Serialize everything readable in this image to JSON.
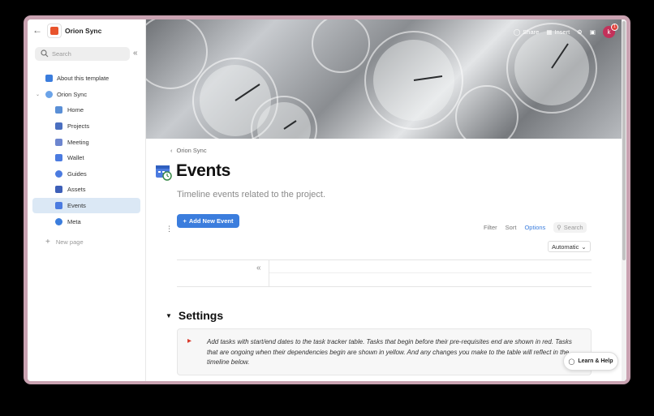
{
  "workspace": {
    "name": "Orion Sync"
  },
  "sidebar": {
    "search_placeholder": "Search",
    "items": [
      {
        "label": "About this template",
        "icon": "info-icon",
        "color": "#3b7ddd"
      },
      {
        "label": "Orion Sync",
        "icon": "workspace-icon",
        "color": "#6ba3e8"
      },
      {
        "label": "Home",
        "icon": "home-icon",
        "color": "#5a8fd6"
      },
      {
        "label": "Projects",
        "icon": "projects-icon",
        "color": "#4a6fc0"
      },
      {
        "label": "Meeting",
        "icon": "meeting-icon",
        "color": "#6d86cf"
      },
      {
        "label": "Wallet",
        "icon": "wallet-icon",
        "color": "#4b7be0"
      },
      {
        "label": "Guides",
        "icon": "compass-icon",
        "color": "#4b7be0"
      },
      {
        "label": "Assets",
        "icon": "assets-icon",
        "color": "#3d5fb8"
      },
      {
        "label": "Events",
        "icon": "calendar-icon",
        "color": "#4b7be0"
      },
      {
        "label": "Meta",
        "icon": "info-icon",
        "color": "#3b7ddd"
      }
    ],
    "new_page_label": "New page"
  },
  "topbar": {
    "share_label": "Share",
    "insert_label": "Insert",
    "avatar_initial": "k",
    "notification_count": "1"
  },
  "page": {
    "breadcrumb": "Orion Sync",
    "title": "Events",
    "description": "Timeline events related to the project.",
    "add_button_label": "Add New Event"
  },
  "view_toolbar": {
    "filter_label": "Filter",
    "sort_label": "Sort",
    "options_label": "Options",
    "search_placeholder": "Search",
    "zoom_label": "Automatic"
  },
  "settings": {
    "heading": "Settings",
    "callout_text": "Add tasks with start/end dates to the task tracker table. Tasks that begin before their pre-requisites end are shown in red. Tasks that are ongoing when their dependencies begin are shown in yellow. And any changes you make to the table will reflect in the timeline below."
  },
  "help": {
    "label": "Learn & Help"
  },
  "colors": {
    "accent": "#3b7ddd",
    "active_nav": "#dbe8f5",
    "frame": "#c9a2b1",
    "avatar": "#c3315a"
  }
}
